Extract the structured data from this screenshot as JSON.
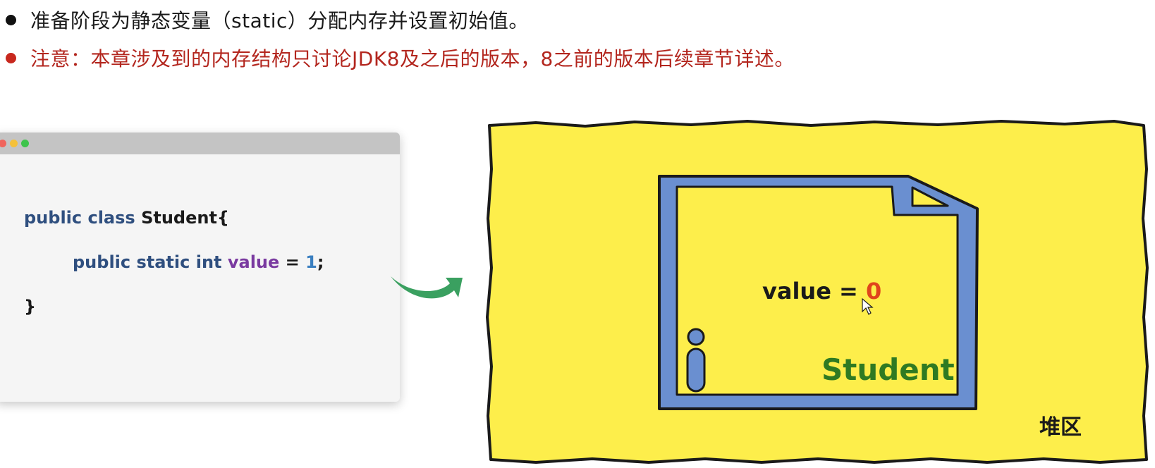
{
  "bullets": [
    {
      "text": "准备阶段为静态变量（static）分配内存并设置初始值。",
      "color": "#1a1a1a"
    },
    {
      "text": "注意：本章涉及到的内存结构只讨论JDK8及之后的版本，8之前的版本后续章节详述。",
      "color": "#b3261e"
    }
  ],
  "code": {
    "line1": {
      "kw": "public class ",
      "cls": "Student{"
    },
    "line2": {
      "kw": "public static int ",
      "var": "value",
      "eq": " = ",
      "num": "1",
      "end": ";"
    },
    "line3": {
      "brace": "}"
    }
  },
  "heap": {
    "value_text": "value = ",
    "value_zero": "0",
    "class_name": "Student",
    "area_label": "堆区",
    "info_icon": "info-icon",
    "colors": {
      "area": "#fdee4b",
      "frame": "#6a8fd0",
      "class_name": "#2f7a22",
      "value_zero": "#e0441c",
      "arrow": "#3aa060"
    }
  }
}
